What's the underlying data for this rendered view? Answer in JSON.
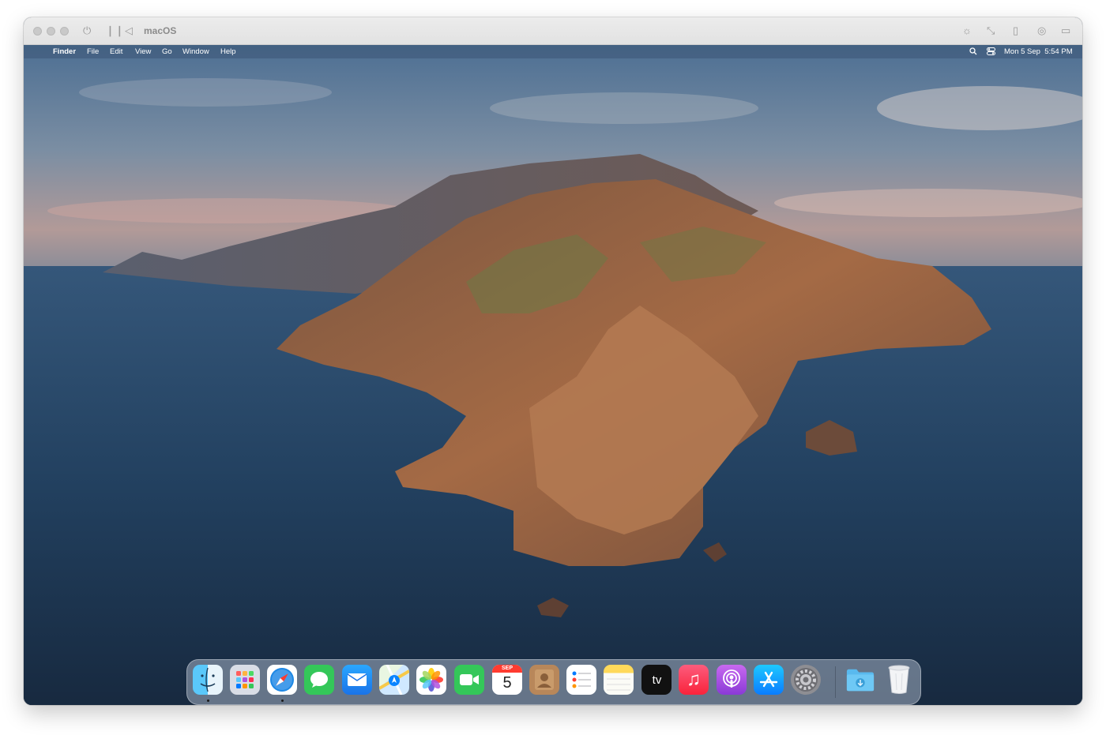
{
  "vm": {
    "title": "macOS",
    "toolbar_icons": [
      "power-icon",
      "pause-icon",
      "back-icon",
      "brightness-icon",
      "resize-icon",
      "usb-icon",
      "display-icon",
      "folder-icon"
    ]
  },
  "menubar": {
    "app_name": "Finder",
    "menus": [
      "File",
      "Edit",
      "View",
      "Go",
      "Window",
      "Help"
    ],
    "clock": "Mon 5 Sep  5:54 PM",
    "status_icons": [
      "search-icon",
      "control-center-icon"
    ]
  },
  "dock": {
    "apps": [
      {
        "name": "Finder",
        "icon": "finder-icon",
        "running": true
      },
      {
        "name": "Launchpad",
        "icon": "launchpad-icon",
        "running": false
      },
      {
        "name": "Safari",
        "icon": "safari-icon",
        "running": true
      },
      {
        "name": "Messages",
        "icon": "messages-icon",
        "running": false
      },
      {
        "name": "Mail",
        "icon": "mail-icon",
        "running": false
      },
      {
        "name": "Maps",
        "icon": "maps-icon",
        "running": false
      },
      {
        "name": "Photos",
        "icon": "photos-icon",
        "running": false
      },
      {
        "name": "FaceTime",
        "icon": "facetime-icon",
        "running": false
      },
      {
        "name": "Calendar",
        "icon": "calendar-icon",
        "running": false,
        "month": "SEP",
        "day": "5"
      },
      {
        "name": "Contacts",
        "icon": "contacts-icon",
        "running": false
      },
      {
        "name": "Reminders",
        "icon": "reminders-icon",
        "running": false
      },
      {
        "name": "Notes",
        "icon": "notes-icon",
        "running": false
      },
      {
        "name": "TV",
        "icon": "tv-icon",
        "running": false,
        "label": "tv"
      },
      {
        "name": "Music",
        "icon": "music-icon",
        "running": false
      },
      {
        "name": "Podcasts",
        "icon": "podcasts-icon",
        "running": false
      },
      {
        "name": "App Store",
        "icon": "app-store-icon",
        "running": false
      },
      {
        "name": "System Preferences",
        "icon": "system-preferences-icon",
        "running": false
      },
      {
        "name": "Downloads",
        "icon": "downloads-folder-icon",
        "running": false
      },
      {
        "name": "Trash",
        "icon": "trash-icon",
        "running": false
      }
    ]
  }
}
